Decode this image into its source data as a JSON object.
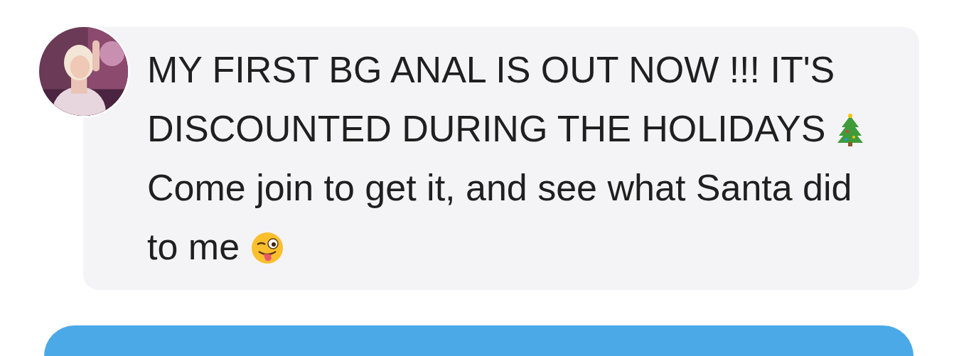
{
  "message": {
    "paragraphs": [
      {
        "lines": [
          "MY FIRST BG ANAL IS OUT NOW !!! IT'S",
          "DISCOUNTED DURING THE HOLIDAYS"
        ],
        "kind": "tree"
      },
      {
        "lines": [
          "Come join to get it, and see what Santa did",
          "to me"
        ],
        "kind": "wink"
      }
    ]
  },
  "next_message": {
    "kind": "outgoing"
  }
}
